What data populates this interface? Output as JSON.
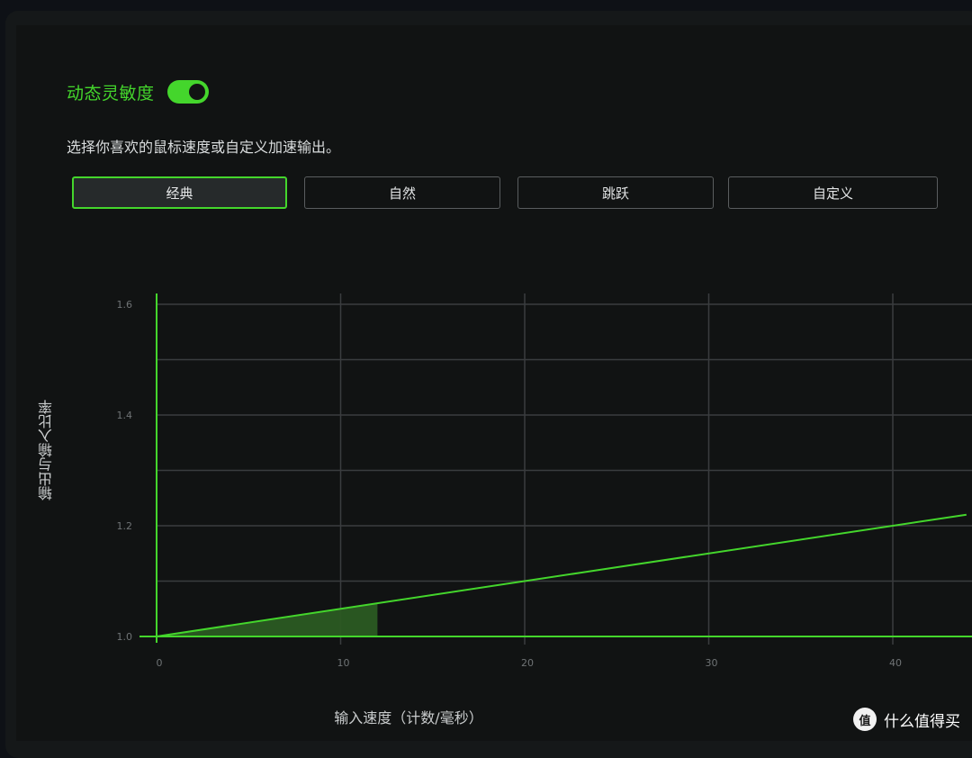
{
  "sensitivity": {
    "title": "动态灵敏度",
    "toggle_on": true,
    "description": "选择你喜欢的鼠标速度或自定义加速输出。"
  },
  "presets": [
    {
      "label": "经典",
      "active": true
    },
    {
      "label": "自然",
      "active": false
    },
    {
      "label": "跳跃",
      "active": false
    },
    {
      "label": "自定义",
      "active": false
    }
  ],
  "colors": {
    "accent": "#44d62c",
    "background": "#111313",
    "gridline": "#3a3d3f"
  },
  "chart_data": {
    "type": "line",
    "xlabel": "输入速度（计数/毫秒）",
    "ylabel": "输出与输入比率",
    "xlim": [
      0,
      44
    ],
    "ylim": [
      1.0,
      1.62
    ],
    "x_ticks": [
      "0",
      "10",
      "20",
      "30",
      "40"
    ],
    "y_ticks": [
      "1.0",
      "1.2",
      "1.4",
      "1.6"
    ],
    "series": [
      {
        "x": [
          0,
          44
        ],
        "y": [
          1.0,
          1.22
        ]
      }
    ],
    "shaded_range": [
      0,
      12
    ],
    "grid": true
  },
  "watermark": {
    "logo_text": "值",
    "text": "什么值得买"
  }
}
